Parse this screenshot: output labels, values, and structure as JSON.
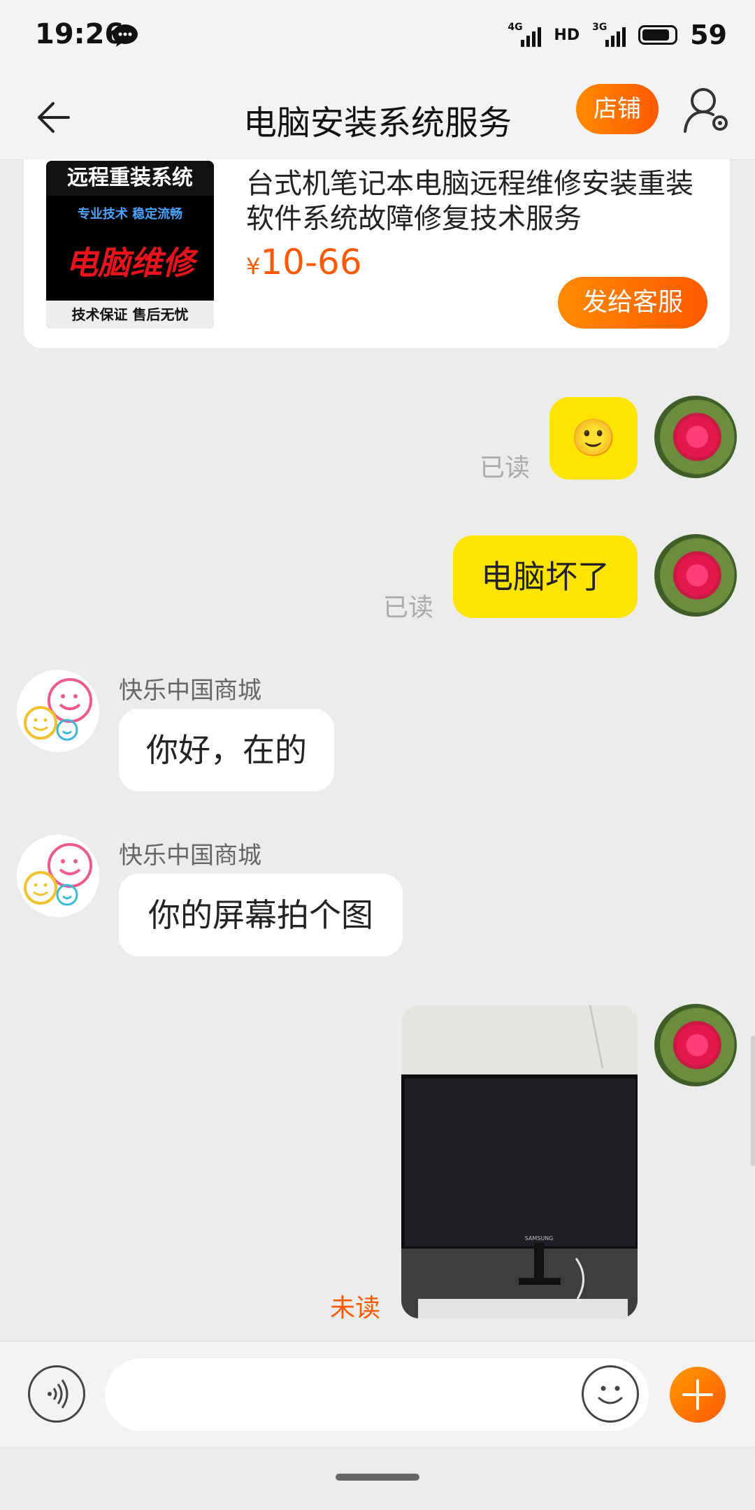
{
  "status_bar": {
    "time": "19:26",
    "net1_tag": "4G",
    "hd_label": "HD",
    "net2_tag": "3G",
    "battery_pct": "59"
  },
  "header": {
    "title": "电脑安装系统服务",
    "shop_label": "店铺"
  },
  "product": {
    "thumb_top": "远程重装系统",
    "thumb_sub": "专业技术 稳定流畅",
    "thumb_main": "电脑维修",
    "thumb_foot": "技术保证  售后无忧",
    "title": "台式机笔记本电脑远程维修安装重装软件系统故障修复技术服务",
    "currency": "¥",
    "price": "10-66",
    "send_label": "发给客服"
  },
  "messages": [
    {
      "side": "mine",
      "type": "emoji",
      "emoji": "🙂",
      "status": "已读"
    },
    {
      "side": "mine",
      "type": "text",
      "text": "电脑坏了",
      "status": "已读"
    },
    {
      "side": "theirs",
      "sender": "快乐中国商城",
      "text": "你好，在的"
    },
    {
      "side": "theirs",
      "sender": "快乐中国商城",
      "text": "你的屏幕拍个图"
    },
    {
      "side": "mine",
      "type": "image",
      "image_label": "SAMSUNG",
      "status": "未读"
    }
  ],
  "input": {
    "placeholder": ""
  },
  "colors": {
    "accent": "#ff5a00",
    "my_bubble": "#ffe400",
    "background": "#ececec"
  }
}
